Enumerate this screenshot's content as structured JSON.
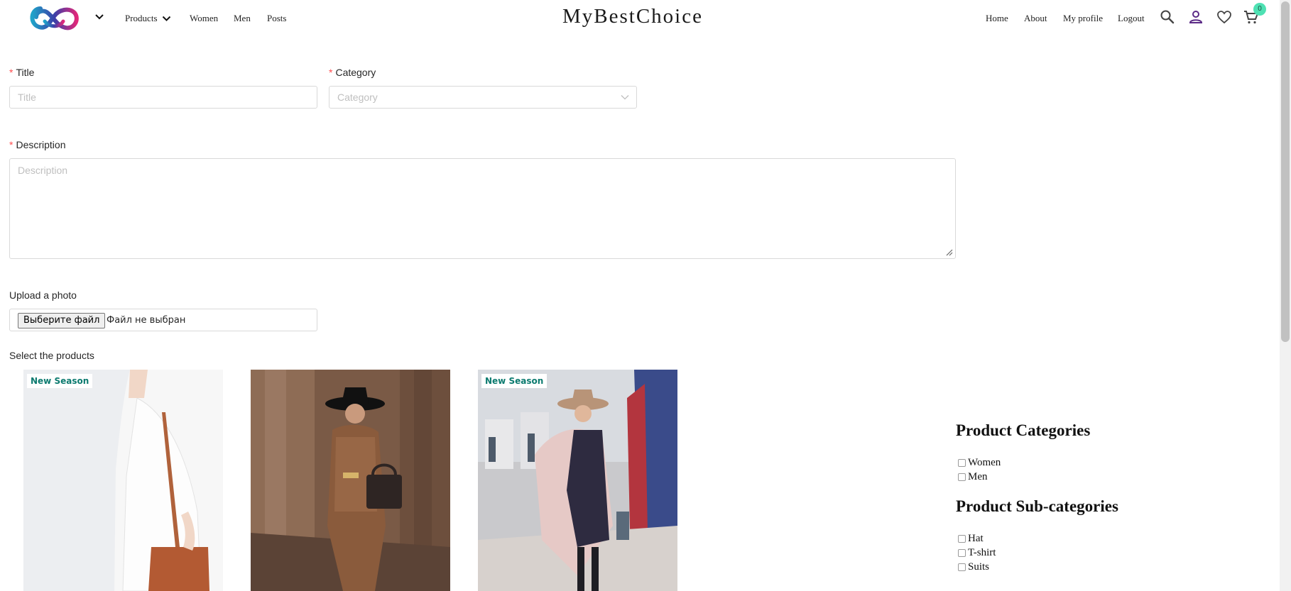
{
  "header": {
    "brand": "MyBestChoice",
    "nav_left": {
      "products": "Products",
      "women": "Women",
      "men": "Men",
      "posts": "Posts"
    },
    "nav_right": {
      "home": "Home",
      "about": "About",
      "my_profile": "My profile",
      "logout": "Logout"
    },
    "cart_count": "0",
    "icons": [
      "logo-icon",
      "chevron-down-icon",
      "search-icon",
      "user-icon",
      "heart-icon",
      "cart-icon"
    ]
  },
  "form": {
    "title_label": "Title",
    "title_placeholder": "Title",
    "category_label": "Category",
    "category_placeholder": "Category",
    "description_label": "Description",
    "description_placeholder": "Description",
    "upload_label": "Upload a photo",
    "file_button": "Выберите файл",
    "file_status": "Файл не выбран",
    "required_mark": "*"
  },
  "products": {
    "label": "Select the products",
    "items": [
      {
        "badge": "New Season"
      },
      {
        "badge": ""
      },
      {
        "badge": "New Season"
      }
    ]
  },
  "sidebar": {
    "categories_title": "Product Categories",
    "categories": [
      "Women",
      "Men"
    ],
    "subcategories_title": "Product Sub-categories",
    "subcategories": [
      "Hat",
      "T-shirt",
      "Suits"
    ]
  },
  "colors": {
    "accent_badge": "#4ee1b3",
    "badge_text": "#0b7a6f",
    "required": "#ff4d4f"
  }
}
